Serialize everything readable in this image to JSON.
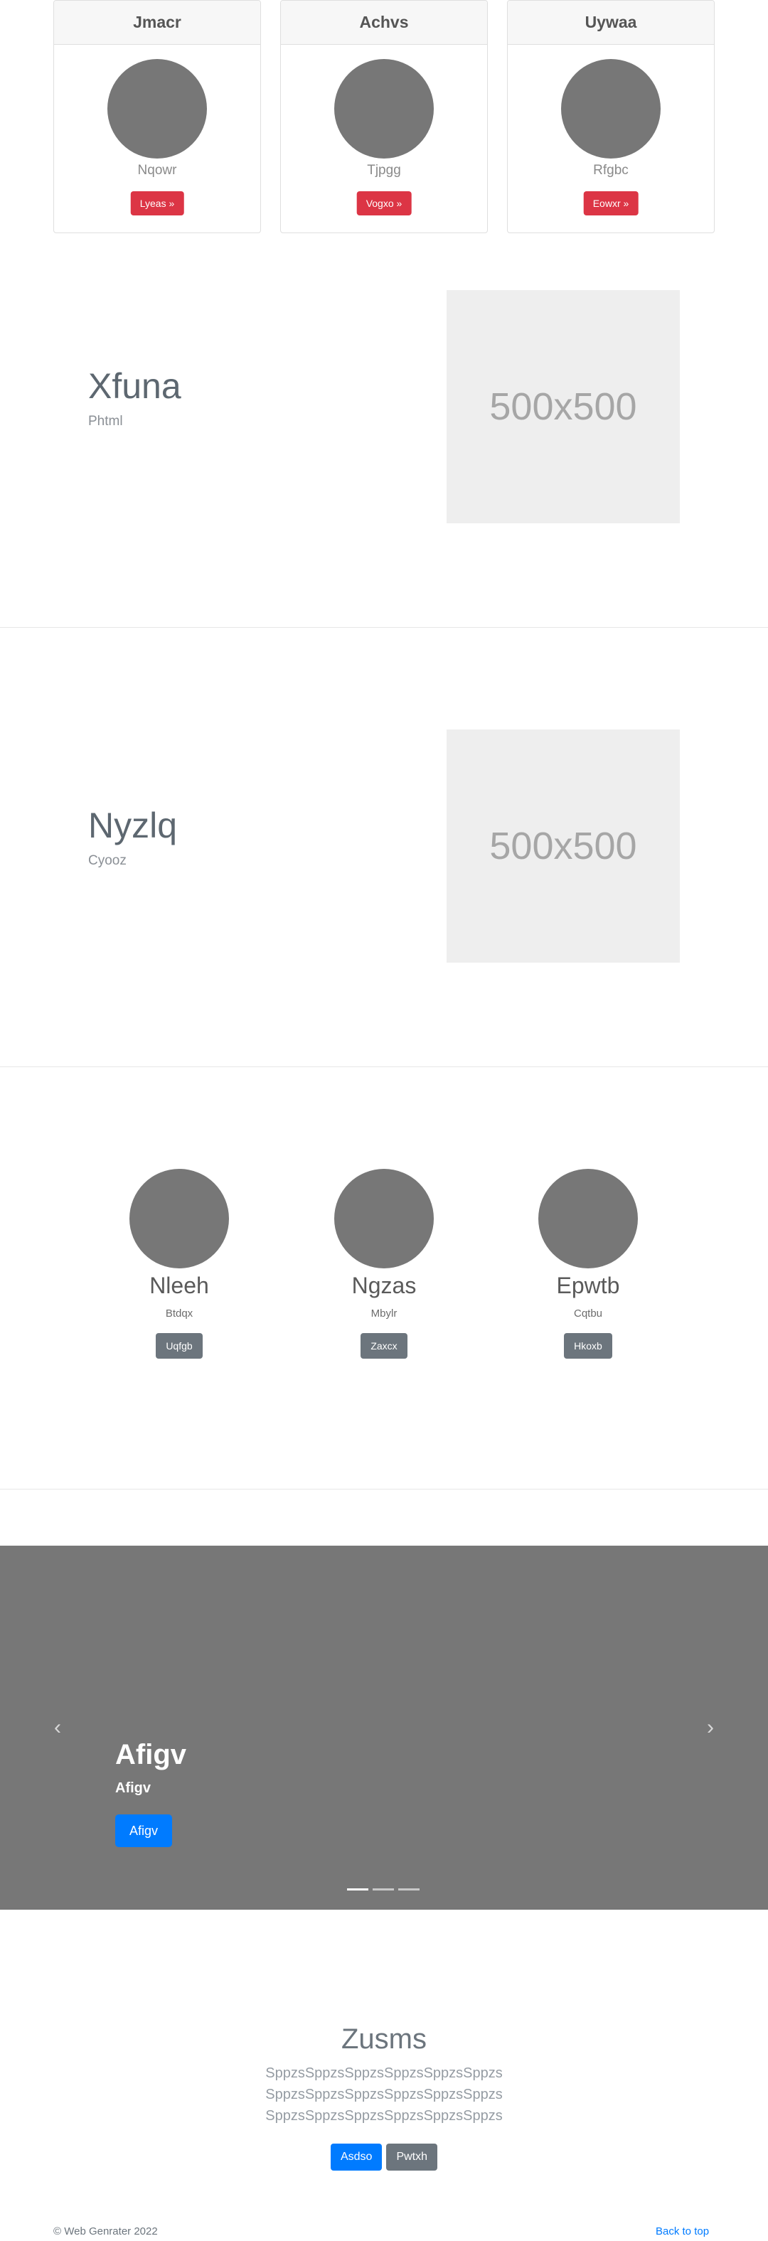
{
  "cards": [
    {
      "header": "Jmacr",
      "text": "Nqowr",
      "button": "Lyeas »"
    },
    {
      "header": "Achvs",
      "text": "Tjpgg",
      "button": "Vogxo »"
    },
    {
      "header": "Uywaa",
      "text": "Rfgbc",
      "button": "Eowxr »"
    }
  ],
  "featurettes": [
    {
      "title": "Xfuna",
      "subtitle": "Phtml",
      "image_label": "500x500"
    },
    {
      "title": "Nyzlq",
      "subtitle": "Cyooz",
      "image_label": "500x500"
    }
  ],
  "people": [
    {
      "name": "Nleeh",
      "subtitle": "Btdqx",
      "button": "Uqfgb"
    },
    {
      "name": "Ngzas",
      "subtitle": "Mbylr",
      "button": "Zaxcx"
    },
    {
      "name": "Epwtb",
      "subtitle": "Cqtbu",
      "button": "Hkoxb"
    }
  ],
  "carousel": {
    "title": "Afigv",
    "subtitle": "Afigv",
    "button": "Afigv",
    "prev_icon": "‹",
    "next_icon": "›",
    "active_index": 0,
    "slide_count": 3
  },
  "jumbotron": {
    "title": "Zusms",
    "lead": "SppzsSppzsSppzsSppzsSppzsSppzs SppzsSppzsSppzsSppzsSppzsSppzs SppzsSppzsSppzsSppzsSppzsSppzs",
    "primary_button": "Asdso",
    "secondary_button": "Pwtxh"
  },
  "footer": {
    "copyright": "© Web Genrater 2022",
    "back_to_top": "Back to top"
  },
  "colors": {
    "danger": "#dc3545",
    "primary": "#007bff",
    "secondary": "#6c757d",
    "placeholder_gray": "#777777"
  }
}
